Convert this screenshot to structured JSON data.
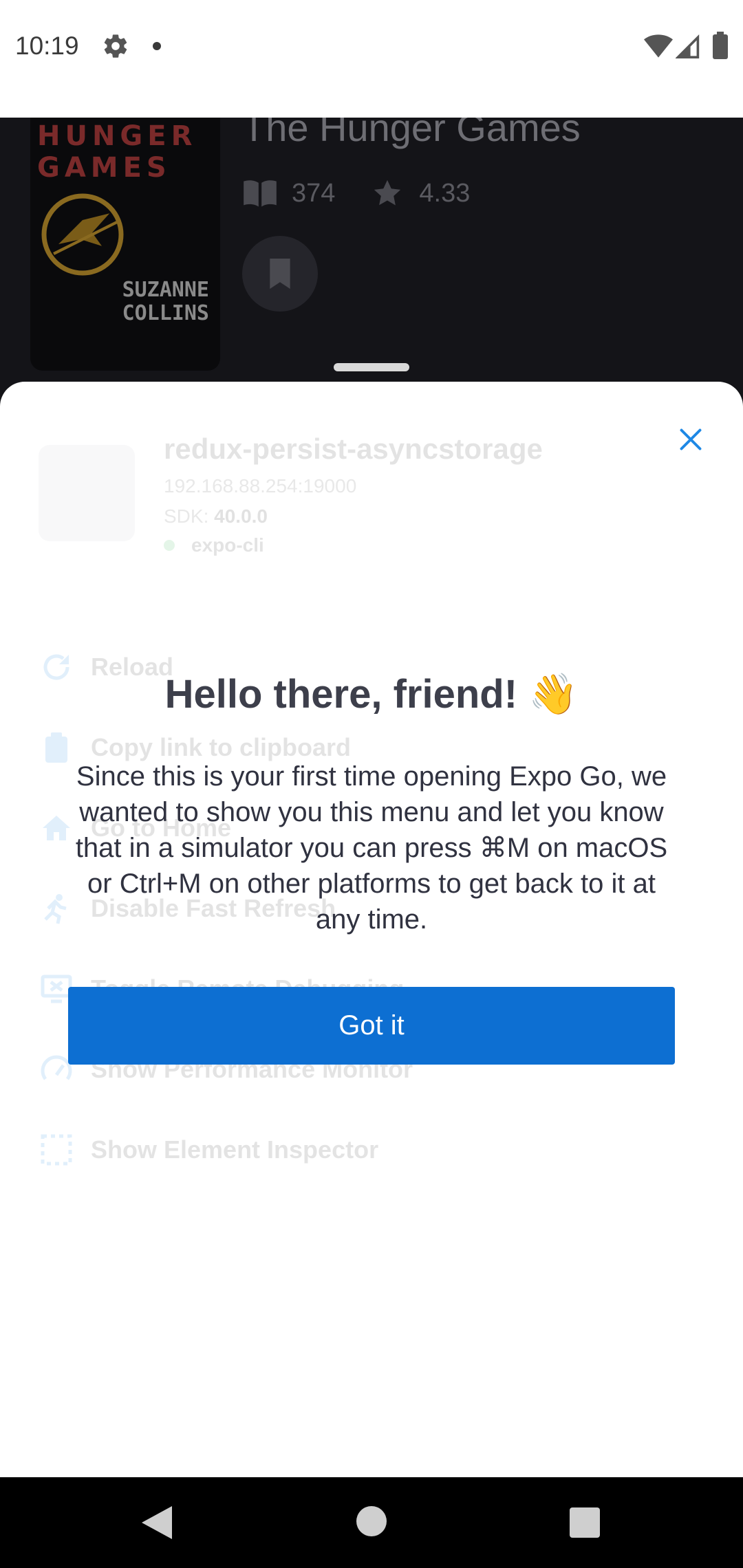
{
  "status_bar": {
    "time": "10:19",
    "icons": [
      "gear-icon",
      "notification-dot-icon",
      "wifi-icon",
      "signal-icon",
      "battery-icon"
    ]
  },
  "app_background": {
    "cover": {
      "title_line1": "HUNGER",
      "title_line2": "GAMES",
      "author_line1": "SUZANNE",
      "author_line2": "COLLINS"
    },
    "book_title": "The Hunger Games",
    "pages": "374",
    "rating": "4.33",
    "icons": [
      "book-open-icon",
      "star-icon",
      "bookmark-icon"
    ]
  },
  "dev_menu": {
    "project_name": "redux-persist-asyncstorage",
    "host": "192.168.88.254:19000",
    "sdk_label": "SDK: ",
    "sdk_version": "40.0.0",
    "runtime": "expo-cli",
    "items": [
      {
        "label": "Reload",
        "icon": "reload-icon"
      },
      {
        "label": "Copy link to clipboard",
        "icon": "clipboard-icon"
      },
      {
        "label": "Go to Home",
        "icon": "home-icon"
      },
      {
        "label": "Disable Fast Refresh",
        "icon": "run-icon"
      },
      {
        "label": "Toggle Remote Debugging",
        "icon": "debug-monitor-icon"
      },
      {
        "label": "Show Performance Monitor",
        "icon": "speedometer-icon"
      },
      {
        "label": "Show Element Inspector",
        "icon": "inspector-icon"
      }
    ]
  },
  "onboarding": {
    "heading": "Hello there, friend!",
    "wave_emoji": "👋",
    "body": "Since this is your first time opening Expo Go, we wanted to show you this menu and let you know that in a simulator you can press ⌘M on macOS or Ctrl+M on other platforms to get back to it at any time.",
    "button_label": "Got it"
  },
  "colors": {
    "accent": "#0d6fd2",
    "close_icon": "#1e88e5",
    "app_background": "#141418"
  }
}
